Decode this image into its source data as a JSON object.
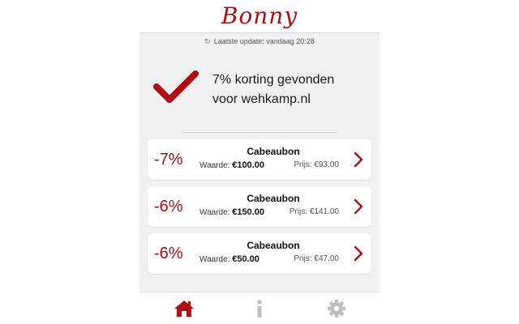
{
  "brand": {
    "name": "Bonny",
    "color": "#b00d12"
  },
  "status": {
    "icon": "refresh-icon",
    "last_update": "Laatste update: vandaag 20:28"
  },
  "result": {
    "icon": "checkmark-icon",
    "line1": "7% korting gevonden",
    "line2": "voor wehkamp.nl"
  },
  "deals": [
    {
      "discount": "-7%",
      "name": "Cabeaubon",
      "value_label": "Waarde:",
      "value": "€100.00",
      "price_label": "Prijs:",
      "price": "€93.00"
    },
    {
      "discount": "-6%",
      "name": "Cabeaubon",
      "value_label": "Waarde:",
      "value": "€150.00",
      "price_label": "Prijs:",
      "price": "€141.00"
    },
    {
      "discount": "-6%",
      "name": "Cabeaubon",
      "value_label": "Waarde:",
      "value": "€50.00",
      "price_label": "Prijs:",
      "price": "€47.00"
    }
  ],
  "tabs": [
    {
      "icon": "home-icon",
      "active": true
    },
    {
      "icon": "info-icon",
      "active": false
    },
    {
      "icon": "gear-icon",
      "active": false
    }
  ],
  "colors": {
    "accent": "#b00d12",
    "inactive_icon": "#bdbdbd",
    "panel_bg": "#f0f0f0"
  }
}
